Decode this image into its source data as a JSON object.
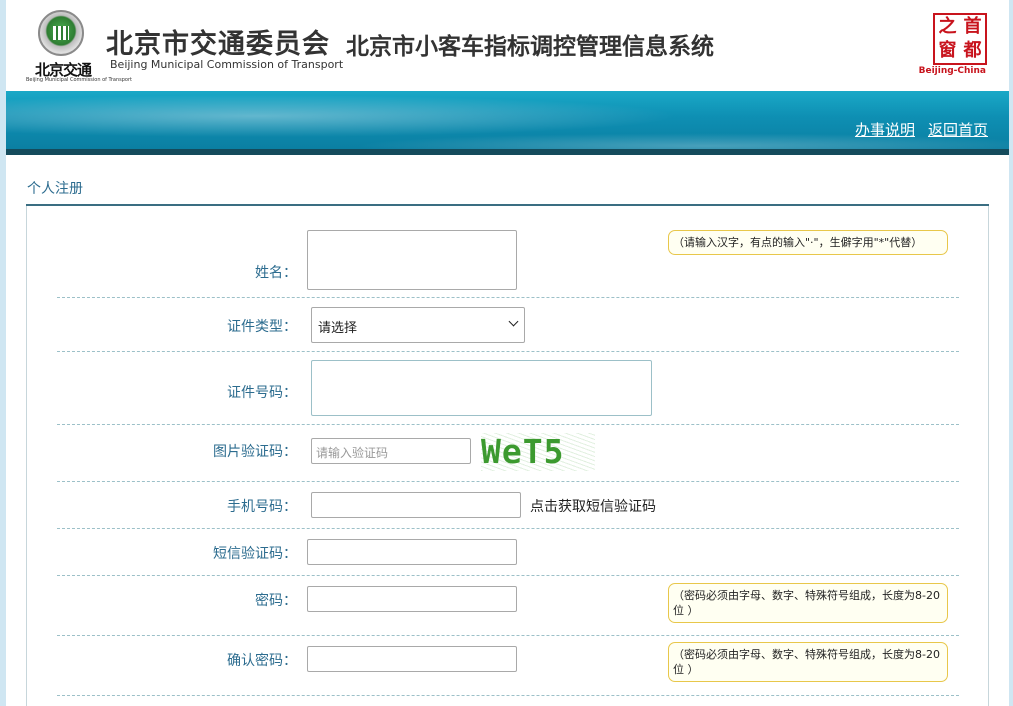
{
  "header": {
    "logo_text": "北京交通",
    "logo_sub": "Beijing Municipal Commission of Transport",
    "org_name_cn": "北京市交通委员会",
    "org_name_en": "Beijing Municipal Commission of Transport",
    "system_title": "北京市小客车指标调控管理信息系统",
    "seal_chars": [
      "之",
      "首",
      "窗",
      "都"
    ],
    "seal_en": "Beijing-China"
  },
  "banner": {
    "links": [
      "办事说明",
      "返回首页"
    ]
  },
  "section": {
    "title": "个人注册"
  },
  "form": {
    "name_label": "姓名：",
    "name_tip": "（请输入汉字，有点的输入\"·\"，生僻字用\"*\"代替）",
    "id_type_label": "证件类型：",
    "id_type_value": "请选择",
    "id_number_label": "证件号码：",
    "captcha_label": "图片验证码：",
    "captcha_placeholder": "请输入验证码",
    "captcha_text": "WeT5",
    "phone_label": "手机号码：",
    "sms_link": "点击获取短信验证码",
    "sms_code_label": "短信验证码：",
    "password_label": "密码：",
    "password_tip": "（密码必须由字母、数字、特殊符号组成，长度为8-20位 ）",
    "confirm_label": "确认密码：",
    "confirm_tip": "（密码必须由字母、数字、特殊符号组成，长度为8-20位 ）"
  },
  "colors": {
    "label": "#2c6c8f",
    "banner": "#0e8fb3",
    "tip_border": "#e8c74a",
    "captcha": "#3c9a2f",
    "seal": "#c8141d"
  }
}
